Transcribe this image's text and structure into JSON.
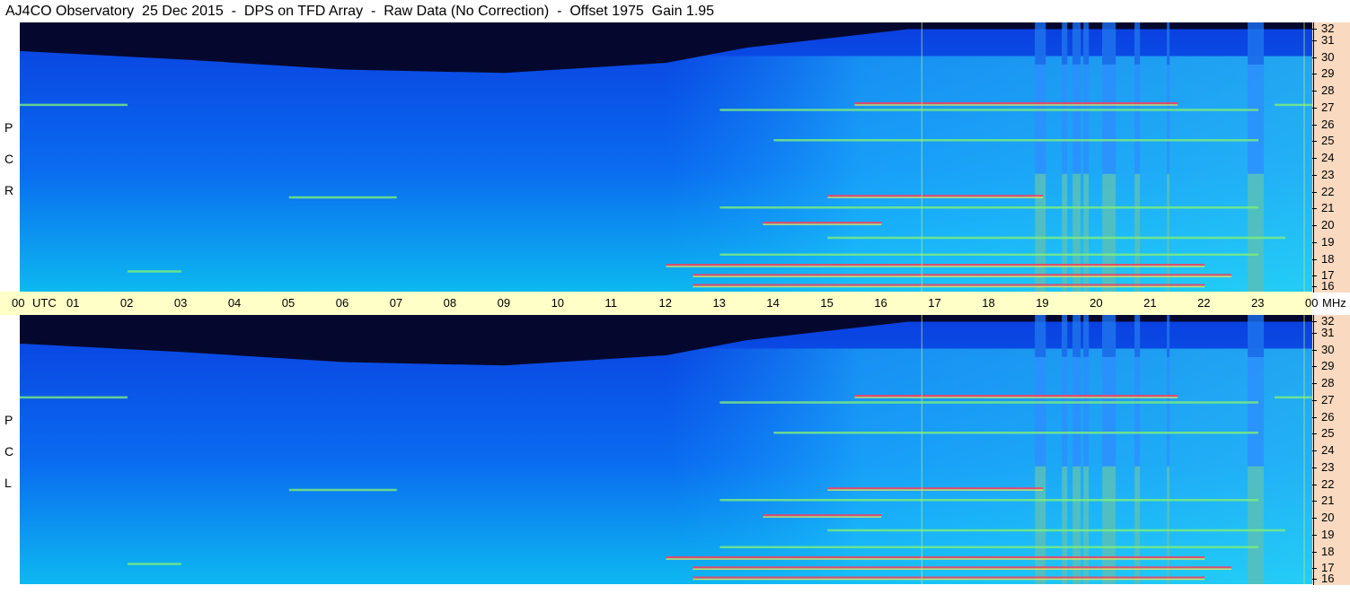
{
  "title": "AJ4CO Observatory  25 Dec 2015  -  DPS on TFD Array  -  Raw Data (No Correction)  -  Offset 1975  Gain 1.95",
  "channels": [
    {
      "id": "rcp",
      "label_chars": [
        "R",
        "C",
        "P"
      ]
    },
    {
      "id": "lcp",
      "label_chars": [
        "L",
        "C",
        "P"
      ]
    }
  ],
  "colors": {
    "background_dark": "#05082e",
    "background_blue": "#0a3fe0",
    "quiet_cyan": "#0db8f0",
    "active_green": "#7ef07a",
    "hot_red": "#ff3b5c",
    "utc_axis_bg": "#ffffc8",
    "freq_axis_bg": "#f9d9bf"
  },
  "chart_data": {
    "type": "heatmap",
    "title": "AJ4CO Observatory  25 Dec 2015  -  DPS on TFD Array  -  Raw Data (No Correction)  -  Offset 1975  Gain 1.95",
    "x_axis": {
      "unit_label": "UTC",
      "range": [
        0,
        24
      ],
      "tick_labels": [
        "00",
        "01",
        "02",
        "03",
        "04",
        "05",
        "06",
        "07",
        "08",
        "09",
        "10",
        "11",
        "12",
        "13",
        "14",
        "15",
        "16",
        "17",
        "18",
        "19",
        "20",
        "21",
        "22",
        "23",
        "00"
      ]
    },
    "y_axis": {
      "unit_label": "MHz",
      "range": [
        16,
        32
      ],
      "tick_labels": [
        "32",
        "31",
        "30",
        "29",
        "28",
        "27",
        "26",
        "25",
        "24",
        "23",
        "22",
        "21",
        "20",
        "19",
        "18",
        "17",
        "16"
      ]
    },
    "panels": [
      "RCP",
      "LCP"
    ],
    "features": {
      "ionospheric_cutoff": [
        {
          "hour": 0,
          "mhz": 30.3
        },
        {
          "hour": 3,
          "mhz": 29.8
        },
        {
          "hour": 6,
          "mhz": 29.2
        },
        {
          "hour": 9,
          "mhz": 29.0
        },
        {
          "hour": 12,
          "mhz": 29.6
        },
        {
          "hour": 13.5,
          "mhz": 30.5
        },
        {
          "hour": 16.5,
          "mhz": 31.6
        },
        {
          "hour": 24,
          "mhz": 31.6
        }
      ],
      "activity_start_hour": 12,
      "bright_columns": [
        {
          "start": 18.85,
          "end": 19.05
        },
        {
          "start": 19.35,
          "end": 19.45
        },
        {
          "start": 19.55,
          "end": 19.7
        },
        {
          "start": 19.75,
          "end": 19.85
        },
        {
          "start": 20.1,
          "end": 20.35
        },
        {
          "start": 20.7,
          "end": 20.8
        },
        {
          "start": 21.3,
          "end": 21.35
        },
        {
          "start": 22.8,
          "end": 23.1
        }
      ],
      "hot_bands": [
        {
          "mhz": 27.2,
          "start": 15.5,
          "end": 21.5
        },
        {
          "mhz": 17.6,
          "start": 12.0,
          "end": 22.0
        },
        {
          "mhz": 17.0,
          "start": 12.5,
          "end": 22.5
        },
        {
          "mhz": 21.7,
          "start": 15.0,
          "end": 19.0
        },
        {
          "mhz": 20.1,
          "start": 13.8,
          "end": 16.0
        },
        {
          "mhz": 16.4,
          "start": 12.5,
          "end": 22.0
        }
      ],
      "green_bands": [
        {
          "mhz": 27.1,
          "start": 0.0,
          "end": 2.0
        },
        {
          "mhz": 27.1,
          "start": 23.3,
          "end": 24.0
        },
        {
          "mhz": 26.8,
          "start": 13.0,
          "end": 23.0
        },
        {
          "mhz": 25.0,
          "start": 14.0,
          "end": 23.0
        },
        {
          "mhz": 21.0,
          "start": 13.0,
          "end": 23.0
        },
        {
          "mhz": 21.6,
          "start": 5.0,
          "end": 7.0
        },
        {
          "mhz": 18.2,
          "start": 13.0,
          "end": 23.0
        },
        {
          "mhz": 17.2,
          "start": 2.0,
          "end": 3.0
        },
        {
          "mhz": 19.2,
          "start": 15.0,
          "end": 23.5
        }
      ],
      "marker_lines_hour": [
        16.75,
        23.85
      ]
    }
  }
}
